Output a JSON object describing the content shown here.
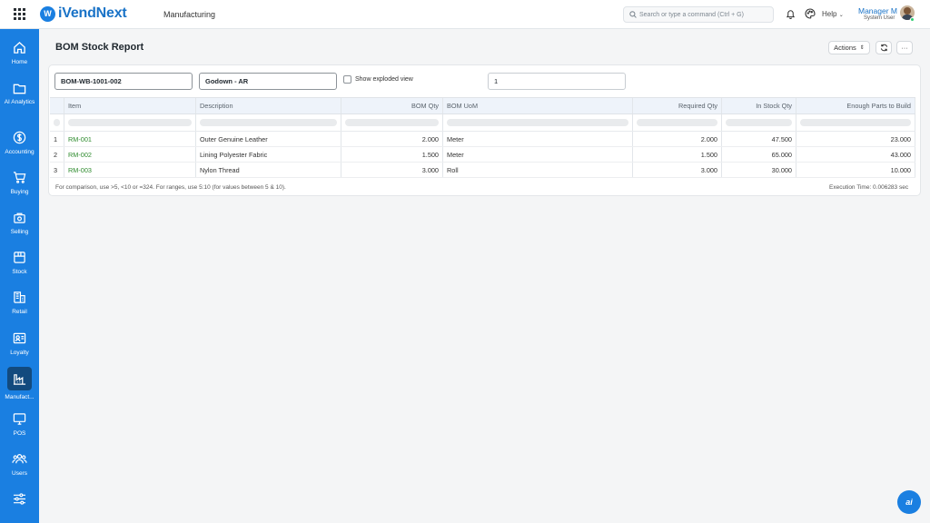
{
  "app": {
    "brand": "iVendNext",
    "brand_logo_letter": "W",
    "module": "Manufacturing",
    "accent_color": "#1a7fe1"
  },
  "header": {
    "search_placeholder": "Search or type a command (Ctrl + G)",
    "help_label": "Help",
    "user_name": "Manager M",
    "user_role": "System User"
  },
  "sidebar": {
    "items": [
      {
        "label": "Home",
        "icon": "home-icon"
      },
      {
        "label": "AI Analytics",
        "icon": "folder-icon"
      },
      {
        "label": "Accounting",
        "icon": "dollar-icon"
      },
      {
        "label": "Buying",
        "icon": "cart-icon"
      },
      {
        "label": "Selling",
        "icon": "bag-icon"
      },
      {
        "label": "Stock",
        "icon": "box-icon"
      },
      {
        "label": "Retail",
        "icon": "store-icon"
      },
      {
        "label": "Loyalty",
        "icon": "id-card-icon"
      },
      {
        "label": "Manufact...",
        "icon": "factory-icon",
        "active": true
      },
      {
        "label": "POS",
        "icon": "monitor-icon"
      },
      {
        "label": "Users",
        "icon": "users-icon"
      },
      {
        "label": "",
        "icon": "sliders-icon"
      }
    ]
  },
  "page": {
    "title": "BOM Stock Report",
    "actions_label": "Actions",
    "more_label": "···"
  },
  "filters": {
    "bom": "BOM-WB-1001-002",
    "warehouse": "Godown - AR",
    "show_exploded_label": "Show exploded view",
    "show_exploded_checked": false,
    "qty": "1"
  },
  "table": {
    "columns": [
      "Item",
      "Description",
      "BOM Qty",
      "BOM UoM",
      "Required Qty",
      "In Stock Qty",
      "Enough Parts to Build"
    ],
    "rows": [
      {
        "idx": "1",
        "item": "RM-001",
        "description": "Outer Genuine Leather",
        "bom_qty": "2.000",
        "bom_uom": "Meter",
        "required_qty": "2.000",
        "in_stock_qty": "47.500",
        "enough_parts": "23.000"
      },
      {
        "idx": "2",
        "item": "RM-002",
        "description": "Lining Polyester Fabric",
        "bom_qty": "1.500",
        "bom_uom": "Meter",
        "required_qty": "1.500",
        "in_stock_qty": "65.000",
        "enough_parts": "43.000"
      },
      {
        "idx": "3",
        "item": "RM-003",
        "description": "Nylon Thread",
        "bom_qty": "3.000",
        "bom_uom": "Roll",
        "required_qty": "3.000",
        "in_stock_qty": "30.000",
        "enough_parts": "10.000"
      }
    ],
    "footer_note": "For comparison, use >5, <10 or =324. For ranges, use 5:10 (for values between 5 & 10).",
    "execution_time": "Execution Time: 0.006283 sec"
  },
  "fab": {
    "label": "ai"
  }
}
